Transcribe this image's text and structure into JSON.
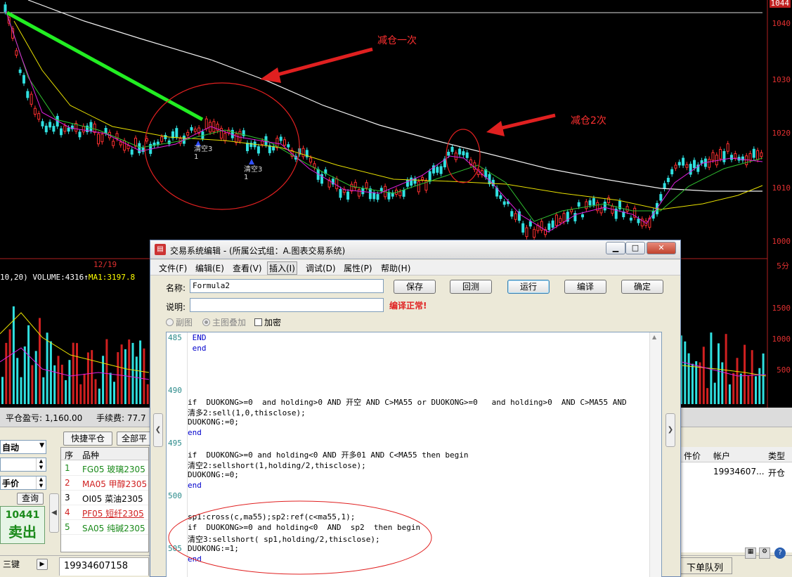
{
  "chart": {
    "price_ticks": [
      "1040",
      "1030",
      "1020",
      "1010",
      "1000"
    ],
    "top_price": "1044",
    "date_label": "12/19",
    "period": "5分",
    "annotation_1": "减仓一次",
    "annotation_2": "减仓2次",
    "signal_labels": [
      {
        "text": "清空3",
        "sub": "1"
      },
      {
        "text": "清空3",
        "sub": "1"
      }
    ],
    "volume_header": "10,20) VOLUME:4316↑",
    "volume_ma": "MA1:3197.8",
    "volume_ticks": [
      "1500",
      "1000",
      "500"
    ]
  },
  "panel": {
    "close_pnl_label": "平仓盈亏: 1,160.00",
    "fee_label": "手续费: 77.7",
    "mode_select": "自动",
    "price_select": "手价",
    "query_button": "查询",
    "quick_close_button": "快捷平仓",
    "close_all_button": "全部平",
    "big_price": "10441",
    "sell_label": "卖出",
    "three_key_button": "三键",
    "account_tab": "19934607158",
    "order_queue_tab": "下单队列",
    "list_headers": {
      "index": "序",
      "symbol": "品种"
    },
    "symbols": [
      {
        "idx": "1",
        "name": "FG05 玻璃2305",
        "color": "#1a8a1a"
      },
      {
        "idx": "2",
        "name": "MA05 甲醇2305",
        "color": "#d02020"
      },
      {
        "idx": "3",
        "name": "OI05 菜油2305",
        "color": "#000000"
      },
      {
        "idx": "4",
        "name": "PF05 短纤2305",
        "color": "#d02020"
      },
      {
        "idx": "5",
        "name": "SA05 纯碱2305",
        "color": "#1a8a1a"
      }
    ],
    "right_headers": {
      "price": "件价",
      "account": "帐户",
      "type": "类型"
    },
    "right_row": {
      "account": "19934607...",
      "type": "开仓"
    }
  },
  "editor": {
    "title": "交易系统编辑 - (所属公式组：A.图表交易系统)",
    "menus": [
      "文件(F)",
      "编辑(E)",
      "查看(V)",
      "插入(I)",
      "调试(D)",
      "属性(P)",
      "帮助(H)"
    ],
    "name_label": "名称:",
    "name_value": "Formula2",
    "desc_label": "说明:",
    "desc_value": "",
    "buttons": {
      "save": "保存",
      "backtest": "回测",
      "run": "运行",
      "compile": "编译",
      "ok": "确定"
    },
    "compile_status": "编译正常!",
    "radio_sub": "副图",
    "radio_main": "主图叠加",
    "check_encrypt": "加密",
    "line_numbers": [
      "485",
      "490",
      "495",
      "500",
      "505"
    ],
    "code_lines": [
      " END",
      " end",
      "",
      "",
      "",
      "",
      "if  DUOKONG>=0  and holding>0 AND 开空 AND C>MA55 or DUOKONG>=0   and holding>0  AND C>MA55 AND",
      "清多2:sell(1,0,thisclose);",
      "DUOKONG:=0;",
      "end",
      "",
      "if  DUOKONG>=0 and holding<0 AND 开多01 AND C<MA55 then begin",
      "清空2:sellshort(1,holding/2,thisclose);",
      "DUOKONG:=0;",
      "end",
      "",
      "",
      "sp1:cross(c,ma55);sp2:ref(c<ma55,1);",
      "if  DUOKONG>=0 and holding<0  AND  sp2  then begin",
      "清空3:sellshort( sp1,holding/2,thisclose);",
      "DUOKONG:=1;",
      "end"
    ]
  }
}
